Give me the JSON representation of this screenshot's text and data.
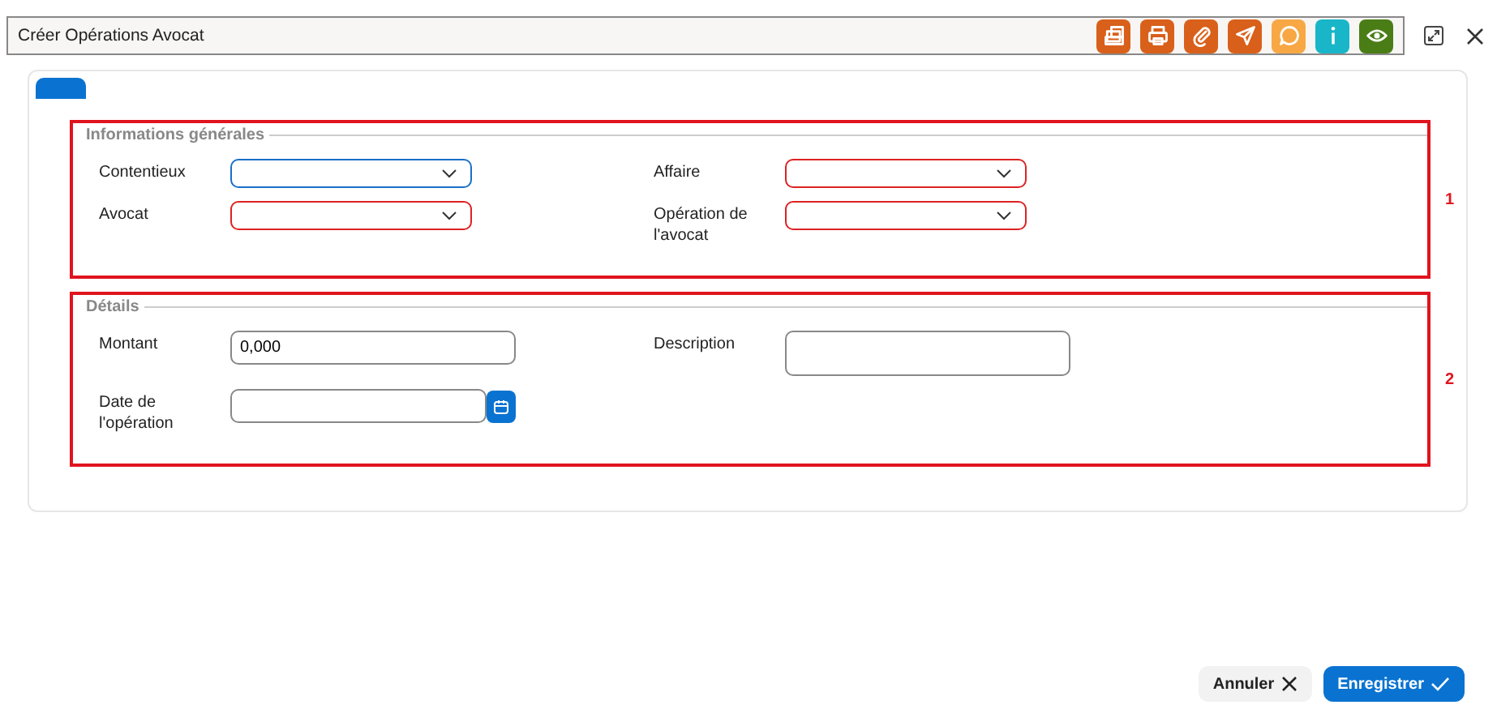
{
  "window": {
    "title": "Créer Opérations Avocat"
  },
  "toolbar": [
    {
      "kind": "documents",
      "color": "#d9601a"
    },
    {
      "kind": "print",
      "color": "#d9601a"
    },
    {
      "kind": "attach",
      "color": "#d9601a"
    },
    {
      "kind": "send",
      "color": "#d9601a"
    },
    {
      "kind": "chat",
      "color": "#f7a844"
    },
    {
      "kind": "info",
      "color": "#19b5c8"
    },
    {
      "kind": "view",
      "color": "#4a7d16"
    }
  ],
  "sections": [
    {
      "title": "Informations générales",
      "annotation": "1",
      "fields": [
        {
          "kind": "select",
          "label": "Contentieux",
          "focused": true,
          "invalid": false
        },
        {
          "kind": "select",
          "label": "Affaire",
          "focused": false,
          "invalid": true
        },
        {
          "kind": "select",
          "label": "Avocat",
          "focused": false,
          "invalid": true
        },
        {
          "kind": "select",
          "label": "Opération de l'avocat",
          "focused": false,
          "invalid": true
        }
      ]
    },
    {
      "title": "Détails",
      "annotation": "2",
      "fields": [
        {
          "kind": "text",
          "label": "Montant",
          "value": "0,000",
          "focused": false,
          "invalid": false
        },
        {
          "kind": "textarea",
          "label": "Description",
          "focused": false,
          "invalid": false
        },
        {
          "kind": "date",
          "label": "Date de l'opération",
          "focused": false,
          "invalid": false
        }
      ]
    }
  ],
  "buttons": [
    {
      "kind": "cancel",
      "label": "Annuler"
    },
    {
      "kind": "save",
      "label": "Enregistrer"
    }
  ]
}
